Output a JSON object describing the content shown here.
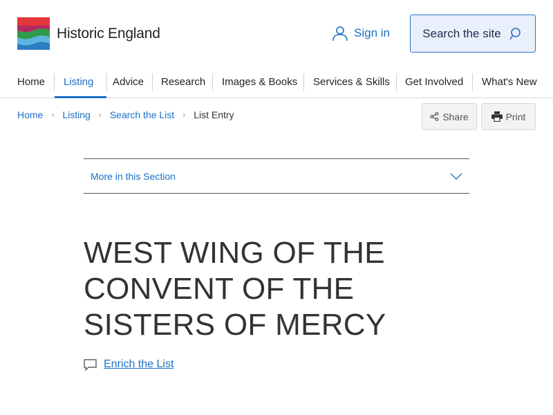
{
  "header": {
    "brand_name": "Historic England",
    "signin_label": "Sign in",
    "search_label": "Search the site"
  },
  "nav": {
    "items": [
      {
        "label": "Home"
      },
      {
        "label": "Listing",
        "active": true
      },
      {
        "label": "Advice"
      },
      {
        "label": "Research"
      },
      {
        "label": "Images & Books"
      },
      {
        "label": "Services & Skills"
      },
      {
        "label": "Get Involved"
      },
      {
        "label": "What's New"
      }
    ]
  },
  "breadcrumb": {
    "items": [
      "Home",
      "Listing",
      "Search the List",
      "List Entry"
    ]
  },
  "toolbar": {
    "share_label": "Share",
    "print_label": "Print"
  },
  "section_menu": {
    "label": "More in this Section"
  },
  "page": {
    "title": "WEST WING OF THE CONVENT OF THE SISTERS OF MERCY",
    "enrich_label": "Enrich the List"
  },
  "colors": {
    "link": "#1b6fc8",
    "text": "#333333",
    "search_bg": "#eaf0fb"
  },
  "icons": [
    "logo-mark",
    "user-icon",
    "search-icon",
    "chevron-right-icon",
    "share-icon",
    "printer-icon",
    "chevron-down-icon",
    "comment-icon"
  ]
}
